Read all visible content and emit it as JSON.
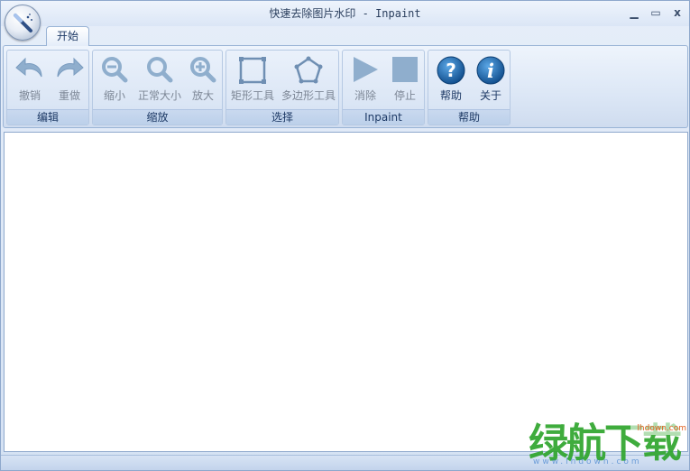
{
  "window": {
    "title_zh": "快速去除图片水印",
    "title_sep": " - ",
    "title_en": "Inpaint",
    "min_label": "▁",
    "max_label": "▭",
    "close_label": "x"
  },
  "tab": {
    "label": "开始"
  },
  "groups": {
    "edit": {
      "label": "编辑",
      "undo": "撤销",
      "redo": "重做"
    },
    "zoom": {
      "label": "缩放",
      "zoom_out": "缩小",
      "actual": "正常大小",
      "zoom_in": "放大"
    },
    "select": {
      "label": "选择",
      "rect": "矩形工具",
      "polygon": "多边形工具"
    },
    "inpaint": {
      "label": "Inpaint",
      "erase": "消除",
      "stop": "停止"
    },
    "help": {
      "label": "帮助",
      "help": "帮助",
      "about": "关于"
    }
  },
  "watermark": {
    "text": "绿航下载",
    "site": "lhdown.com",
    "url": "www.lhdown.com"
  },
  "colors": {
    "icon_disabled": "#8faecd",
    "icon_help": "#1d6fb3",
    "watermark": "#2fa52d"
  }
}
